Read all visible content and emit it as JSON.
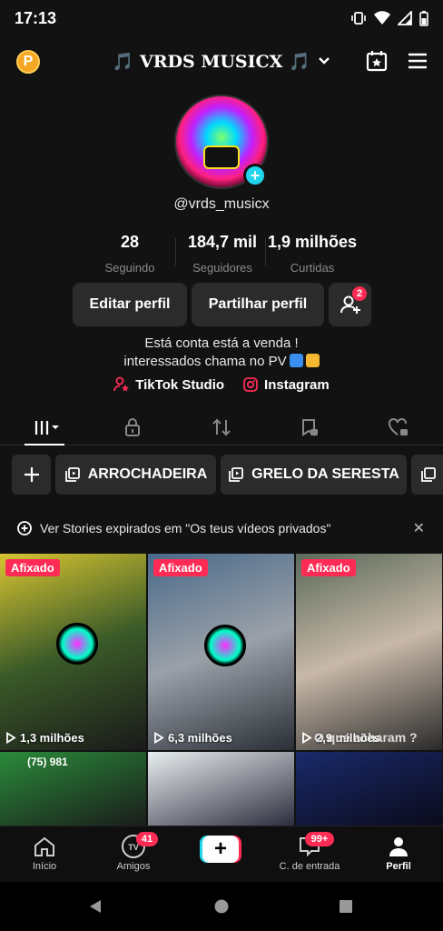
{
  "status": {
    "time": "17:13"
  },
  "header": {
    "title": "VRDS MUSICX",
    "note_left": "🎵",
    "note_right": "🎵",
    "coin_letter": "P"
  },
  "profile": {
    "handle": "@vrds_musicx",
    "stats": [
      {
        "value": "28",
        "label": "Seguindo"
      },
      {
        "value": "184,7 mil",
        "label": "Seguidores"
      },
      {
        "value": "1,9 milhões",
        "label": "Curtidas"
      }
    ],
    "edit_label": "Editar perfil",
    "share_label": "Partilhar perfil",
    "add_friends_badge": "2",
    "bio_line1": "Está conta está a venda !",
    "bio_line2": "interessados chama no PV",
    "links": [
      {
        "label": "TikTok Studio"
      },
      {
        "label": "Instagram"
      }
    ]
  },
  "playlists": [
    {
      "label": "ARROCHADEIRA"
    },
    {
      "label": "GRELO DA SERESTA"
    }
  ],
  "stories_notice": "Ver Stories expirados em \"Os teus vídeos privados\"",
  "videos": [
    {
      "pinned": "Afixado",
      "views": "1,3 milhões",
      "colors": [
        "#d8c430",
        "#3a5a28",
        "#1a1a1a"
      ]
    },
    {
      "pinned": "Afixado",
      "views": "6,3 milhões",
      "colors": [
        "#4a6a8a",
        "#9aa0a8",
        "#2a2f36"
      ]
    },
    {
      "pinned": "Afixado",
      "views": "2,9 milhões",
      "colors": [
        "#5a6a5a",
        "#c8b8a8",
        "#2a2a2a"
      ],
      "caption": "O que acharam ?"
    },
    {
      "colors": [
        "#2a8a3a",
        "#1a1a1a"
      ],
      "caption": "(75) 981"
    },
    {
      "colors": [
        "#e8eef0",
        "#2a2a3a"
      ]
    },
    {
      "colors": [
        "#1a2a6a",
        "#0a0a1a"
      ]
    }
  ],
  "bottom_nav": [
    {
      "label": "Início"
    },
    {
      "label": "Amigos",
      "badge": "41"
    },
    {
      "label": ""
    },
    {
      "label": "C. de entrada",
      "badge": "99+"
    },
    {
      "label": "Perfil"
    }
  ]
}
